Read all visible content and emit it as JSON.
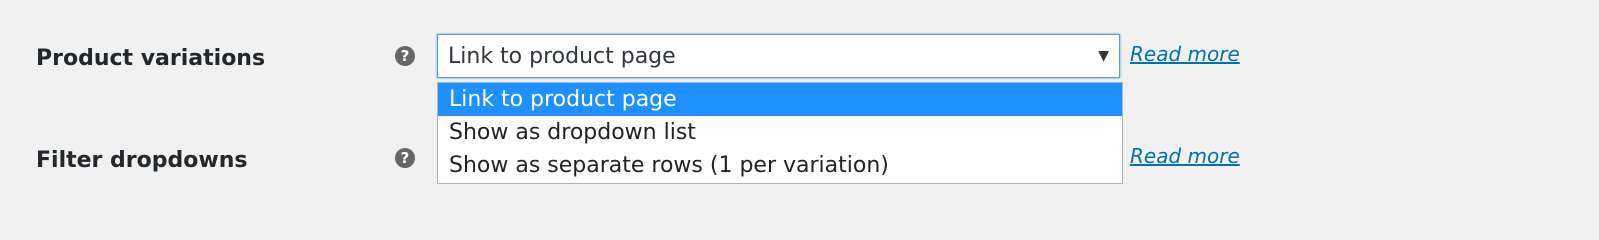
{
  "settings": [
    {
      "label": "Product variations",
      "help_icon": "?",
      "read_more": "Read more"
    },
    {
      "label": "Filter dropdowns",
      "help_icon": "?",
      "read_more": "Read more"
    }
  ],
  "variations_select": {
    "value": "Link to product page",
    "arrow": "▼",
    "options": [
      "Link to product page",
      "Show as dropdown list",
      "Show as separate rows (1 per variation)"
    ],
    "highlighted_index": 0
  },
  "colors": {
    "highlight": "#1e90ff",
    "link": "#0073aa",
    "background": "#f1f1f1"
  }
}
